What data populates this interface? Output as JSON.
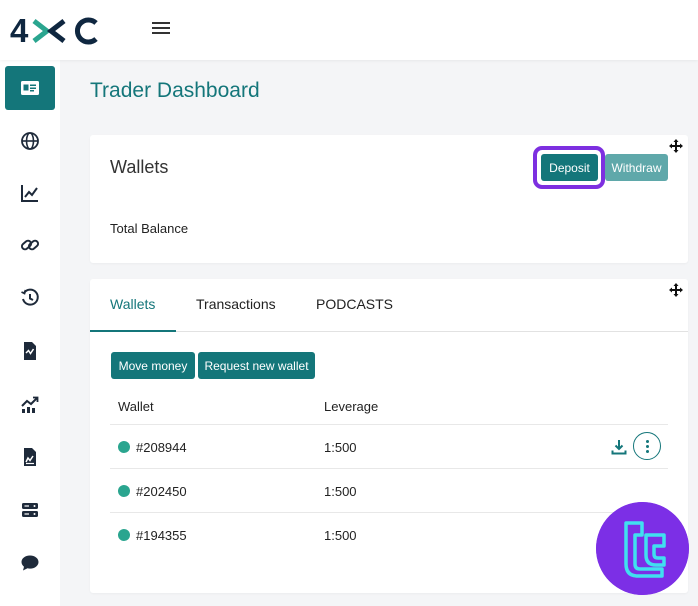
{
  "brand": {
    "logo_text": "4XC",
    "accent": "#14767a",
    "dark": "#0f2740"
  },
  "sidebar": {
    "items": [
      {
        "icon": "id-card-icon",
        "active": true
      },
      {
        "icon": "globe-icon"
      },
      {
        "icon": "line-chart-icon"
      },
      {
        "icon": "link-icon"
      },
      {
        "icon": "history-icon"
      },
      {
        "icon": "file-chart-icon"
      },
      {
        "icon": "trend-chart-icon"
      },
      {
        "icon": "report-icon"
      },
      {
        "icon": "server-icon"
      },
      {
        "icon": "chat-icon"
      }
    ]
  },
  "page": {
    "title": "Trader Dashboard"
  },
  "wallets_card": {
    "title": "Wallets",
    "total_balance_label": "Total Balance",
    "deposit_label": "Deposit",
    "withdraw_label": "Withdraw"
  },
  "tabs": [
    {
      "label": "Wallets",
      "active": true
    },
    {
      "label": "Transactions"
    },
    {
      "label": "PODCASTS"
    }
  ],
  "actions": {
    "move_money_label": "Move money",
    "request_wallet_label": "Request new wallet"
  },
  "table": {
    "headers": [
      "Wallet",
      "Leverage"
    ],
    "rows": [
      {
        "wallet": "#208944",
        "leverage": "1:500"
      },
      {
        "wallet": "#202450",
        "leverage": "1:500"
      },
      {
        "wallet": "#194355",
        "leverage": "1:500"
      }
    ]
  }
}
